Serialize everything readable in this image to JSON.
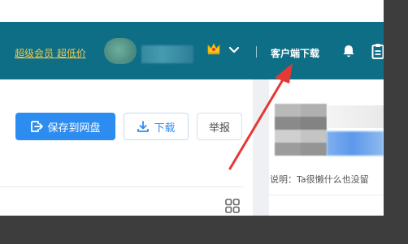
{
  "header": {
    "vip_link": "超级会员 超低价",
    "client_download": "客户端下载",
    "icons": {
      "crown": "crown-icon",
      "chevron": "chevron-down-icon",
      "bell": "bell-icon",
      "clipboard": "clipboard-icon"
    }
  },
  "actions": {
    "save_label": "保存到网盘",
    "download_label": "下载",
    "report_label": "举报"
  },
  "profile": {
    "description": "说明：Ta很懒什么也没留"
  },
  "colors": {
    "header_bg": "#0d6e86",
    "vip_text": "#f2c94c",
    "primary_button": "#2d8cf0",
    "annotation_arrow": "#e53935"
  }
}
